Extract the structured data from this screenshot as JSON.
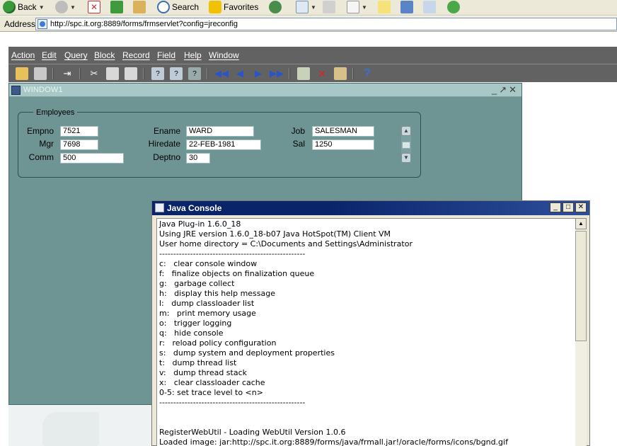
{
  "ie_toolbar": {
    "back_label": "Back",
    "search_label": "Search",
    "favorites_label": "Favorites"
  },
  "address_bar": {
    "label": "Address",
    "url": "http://spc.it.org:8889/forms/frmservlet?config=jreconfig"
  },
  "menubar": {
    "items": [
      "Action",
      "Edit",
      "Query",
      "Block",
      "Record",
      "Field",
      "Help",
      "Window"
    ]
  },
  "form_window": {
    "title": "WINDOW1",
    "frame_title": "Employees",
    "fields": {
      "empno_label": "Empno",
      "empno_value": "7521",
      "ename_label": "Ename",
      "ename_value": "WARD",
      "job_label": "Job",
      "job_value": "SALESMAN",
      "mgr_label": "Mgr",
      "mgr_value": "7698",
      "hiredate_label": "Hiredate",
      "hiredate_value": "22-FEB-1981",
      "sal_label": "Sal",
      "sal_value": "1250",
      "comm_label": "Comm",
      "comm_value": "500",
      "deptno_label": "Deptno",
      "deptno_value": "30"
    }
  },
  "java_console": {
    "title": "Java Console",
    "lines": [
      "Java Plug-in 1.6.0_18",
      "Using JRE version 1.6.0_18-b07 Java HotSpot(TM) Client VM",
      "User home directory = C:\\Documents and Settings\\Administrator",
      "----------------------------------------------------",
      "c:   clear console window",
      "f:   finalize objects on finalization queue",
      "g:   garbage collect",
      "h:   display this help message",
      "l:   dump classloader list",
      "m:   print memory usage",
      "o:   trigger logging",
      "q:   hide console",
      "r:   reload policy configuration",
      "s:   dump system and deployment properties",
      "t:   dump thread list",
      "v:   dump thread stack",
      "x:   clear classloader cache",
      "0-5: set trace level to <n>",
      "----------------------------------------------------",
      "",
      "",
      "RegisterWebUtil - Loading WebUtil Version 1.0.6",
      "Loaded image: jar:http://spc.it.org:8889/forms/java/frmall.jar!/oracle/forms/icons/bgnd.gif"
    ]
  },
  "colors": {
    "forms_canvas": "#6f9494",
    "menubar_bg": "#626262",
    "console_titlebar": "#0a246a"
  }
}
